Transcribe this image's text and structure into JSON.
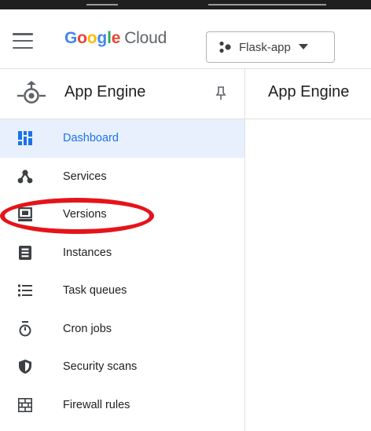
{
  "header": {
    "brand": {
      "letters": [
        {
          "ch": "G",
          "color": "#4285F4"
        },
        {
          "ch": "o",
          "color": "#EA4335"
        },
        {
          "ch": "o",
          "color": "#FBBC05"
        },
        {
          "ch": "g",
          "color": "#4285F4"
        },
        {
          "ch": "l",
          "color": "#34A853"
        },
        {
          "ch": "e",
          "color": "#EA4335"
        }
      ],
      "product": "Cloud"
    },
    "project_picker": {
      "label": "Flask-app",
      "icon": "project-dots-icon"
    }
  },
  "sidebar": {
    "title": "App Engine",
    "items": [
      {
        "label": "Dashboard",
        "icon": "dashboard-icon",
        "active": true
      },
      {
        "label": "Services",
        "icon": "services-icon"
      },
      {
        "label": "Versions",
        "icon": "versions-icon"
      },
      {
        "label": "Instances",
        "icon": "instances-icon"
      },
      {
        "label": "Task queues",
        "icon": "task-queues-icon"
      },
      {
        "label": "Cron jobs",
        "icon": "cron-jobs-icon"
      },
      {
        "label": "Security scans",
        "icon": "security-scans-icon"
      },
      {
        "label": "Firewall rules",
        "icon": "firewall-rules-icon"
      }
    ]
  },
  "main": {
    "title": "App Engine"
  },
  "colors": {
    "accent": "#1a73e8",
    "active_bg": "#e8f0fe",
    "annotation": "#e5141b",
    "icon": "#3c4043"
  }
}
